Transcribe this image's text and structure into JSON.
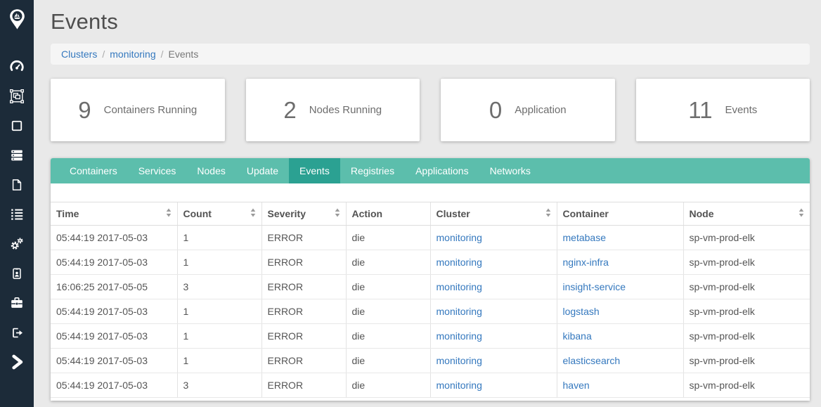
{
  "app": {
    "sidebar_bg": "#1c2b39",
    "sidebar_icons": [
      "logo-pin-boat",
      "dashboard-gauge",
      "cluster-box",
      "container-square",
      "server-stack",
      "document",
      "list",
      "settings-gears",
      "id-badge",
      "toolbox",
      "sign-out",
      "expand-chevron"
    ]
  },
  "header": {
    "title": "Events"
  },
  "breadcrumb": {
    "items": [
      {
        "label": "Clusters",
        "link": true
      },
      {
        "label": "monitoring",
        "link": true
      },
      {
        "label": "Events",
        "link": false
      }
    ]
  },
  "stats": [
    {
      "value": "9",
      "label": "Containers Running"
    },
    {
      "value": "2",
      "label": "Nodes Running"
    },
    {
      "value": "0",
      "label": "Application"
    },
    {
      "value": "11",
      "label": "Events"
    }
  ],
  "tabs": {
    "active": "Events",
    "items": [
      {
        "label": "Containers"
      },
      {
        "label": "Services"
      },
      {
        "label": "Nodes"
      },
      {
        "label": "Update"
      },
      {
        "label": "Events"
      },
      {
        "label": "Registries"
      },
      {
        "label": "Applications"
      },
      {
        "label": "Networks"
      }
    ]
  },
  "table": {
    "columns": [
      {
        "label": "Time",
        "sortable": true
      },
      {
        "label": "Count",
        "sortable": true
      },
      {
        "label": "Severity",
        "sortable": true
      },
      {
        "label": "Action",
        "sortable": false
      },
      {
        "label": "Cluster",
        "sortable": true
      },
      {
        "label": "Container",
        "sortable": false
      },
      {
        "label": "Node",
        "sortable": true
      }
    ],
    "rows": [
      {
        "time": "05:44:19 2017-05-03",
        "count": "1",
        "severity": "ERROR",
        "action": "die",
        "cluster": "monitoring",
        "container": "metabase",
        "node": "sp-vm-prod-elk"
      },
      {
        "time": "05:44:19 2017-05-03",
        "count": "1",
        "severity": "ERROR",
        "action": "die",
        "cluster": "monitoring",
        "container": "nginx-infra",
        "node": "sp-vm-prod-elk"
      },
      {
        "time": "16:06:25 2017-05-05",
        "count": "3",
        "severity": "ERROR",
        "action": "die",
        "cluster": "monitoring",
        "container": "insight-service",
        "node": "sp-vm-prod-elk"
      },
      {
        "time": "05:44:19 2017-05-03",
        "count": "1",
        "severity": "ERROR",
        "action": "die",
        "cluster": "monitoring",
        "container": "logstash",
        "node": "sp-vm-prod-elk"
      },
      {
        "time": "05:44:19 2017-05-03",
        "count": "1",
        "severity": "ERROR",
        "action": "die",
        "cluster": "monitoring",
        "container": "kibana",
        "node": "sp-vm-prod-elk"
      },
      {
        "time": "05:44:19 2017-05-03",
        "count": "1",
        "severity": "ERROR",
        "action": "die",
        "cluster": "monitoring",
        "container": "elasticsearch",
        "node": "sp-vm-prod-elk"
      },
      {
        "time": "05:44:19 2017-05-03",
        "count": "3",
        "severity": "ERROR",
        "action": "die",
        "cluster": "monitoring",
        "container": "haven",
        "node": "sp-vm-prod-elk"
      }
    ]
  },
  "colors": {
    "tab_bar": "#5cbeac",
    "tab_active": "#2ba192",
    "link": "#3478be",
    "sidebar_bg": "#1c2b39",
    "page_bg": "#e9e9e9",
    "breadcrumb_bg": "#f5f5f5"
  }
}
